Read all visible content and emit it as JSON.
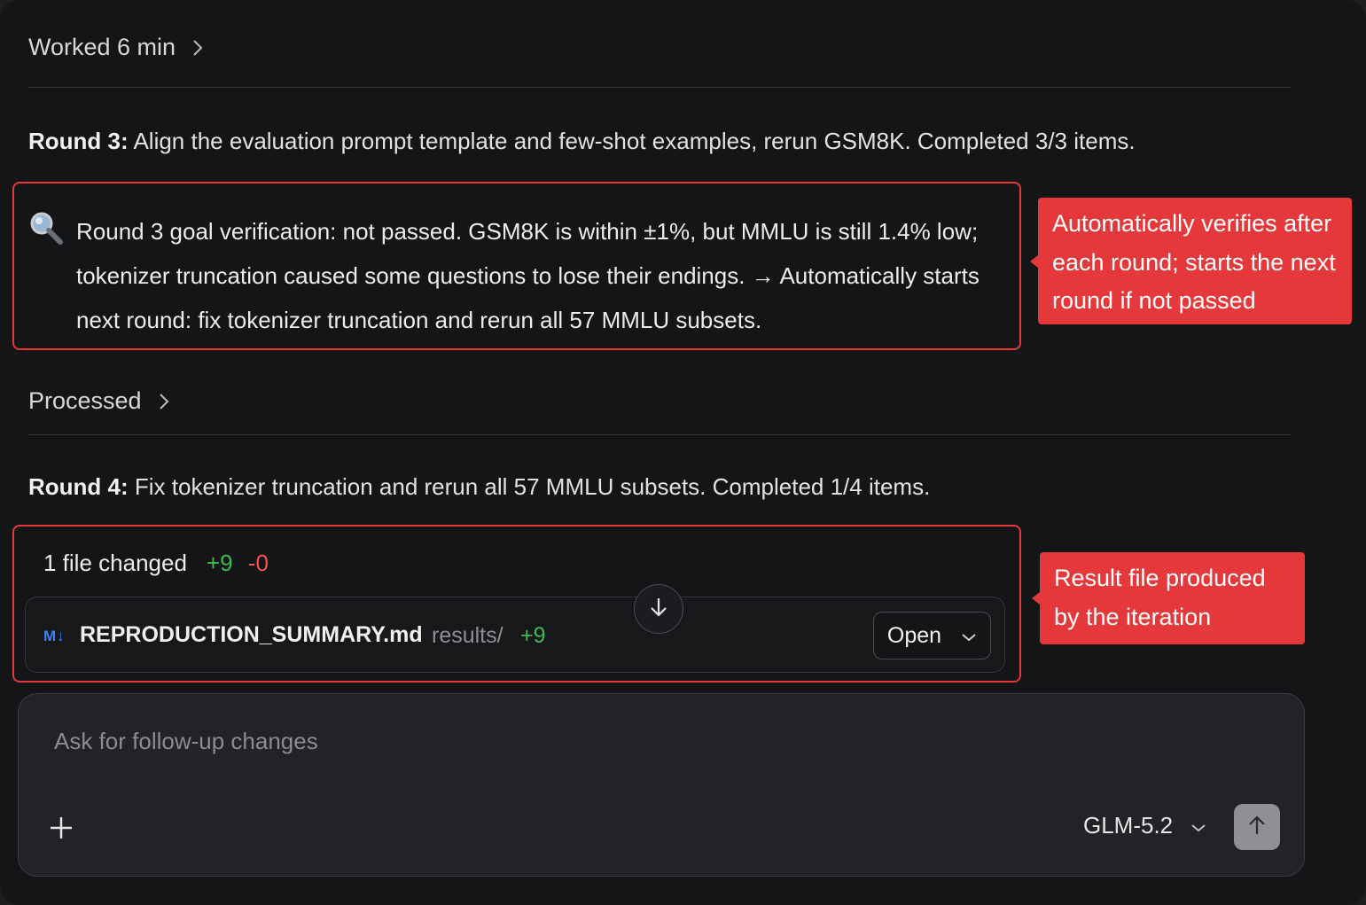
{
  "worked": {
    "label": "Worked 6 min",
    "icon": "chevron-right-icon"
  },
  "round3": {
    "prefix": "Round 3:",
    "text": "Align the evaluation prompt template and few-shot examples, rerun GSM8K. Completed 3/3 items."
  },
  "verification": {
    "icon": "magnifier-icon",
    "text": "Round 3 goal verification: not passed. GSM8K is within ±1%, but MMLU is still 1.4% low; tokenizer truncation caused some questions to lose their endings. → Automatically starts next round: fix tokenizer truncation and rerun all 57 MMLU subsets."
  },
  "callout_verify": {
    "text": "Automatically verifies after each round; starts the next round if not passed"
  },
  "processed": {
    "label": "Processed",
    "icon": "chevron-right-icon"
  },
  "round4": {
    "prefix": "Round 4:",
    "text": "Fix tokenizer truncation and rerun all 57 MMLU subsets. Completed 1/4 items."
  },
  "changes": {
    "summary": "1 file changed",
    "additions": "+9",
    "deletions": "-0",
    "file": {
      "icon_text": "M↓",
      "name": "REPRODUCTION_SUMMARY.md",
      "path": "results/",
      "additions": "+9",
      "open_label": "Open"
    }
  },
  "callout_result": {
    "text": "Result file produced by the iteration"
  },
  "composer": {
    "placeholder": "Ask for follow-up changes",
    "model": "GLM-5.2"
  },
  "colors": {
    "accent_red": "#e5383b",
    "add_green": "#3fb950",
    "del_red": "#f85149",
    "md_blue": "#3b82f6"
  }
}
